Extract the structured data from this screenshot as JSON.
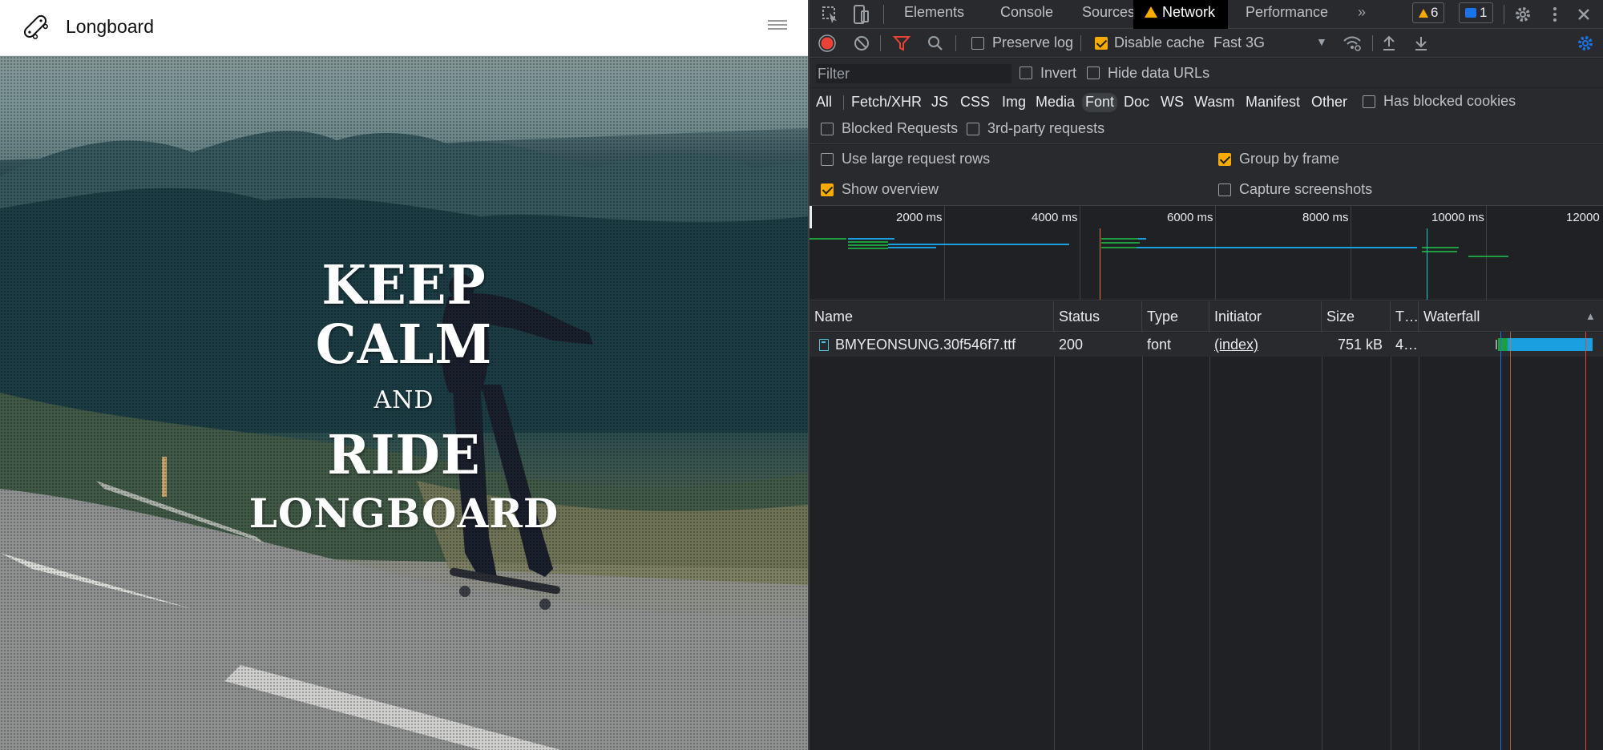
{
  "site": {
    "brand": "Longboard",
    "hero": {
      "line1": "KEEP",
      "line2": "CALM",
      "line3": "AND",
      "line4": "RIDE",
      "line5": "LONGBOARD"
    }
  },
  "devtools": {
    "tabs": [
      "Elements",
      "Console",
      "Sources",
      "Network",
      "Performance"
    ],
    "active_tab": "Network",
    "warnings_count": "6",
    "messages_count": "1",
    "toolbar": {
      "preserve_log": "Preserve log",
      "disable_cache": "Disable cache",
      "throttling": "Fast 3G"
    },
    "filter": {
      "placeholder": "Filter",
      "invert": "Invert",
      "hide_data_urls": "Hide data URLs"
    },
    "types": [
      "All",
      "Fetch/XHR",
      "JS",
      "CSS",
      "Img",
      "Media",
      "Font",
      "Doc",
      "WS",
      "Wasm",
      "Manifest",
      "Other"
    ],
    "selected_type": "Font",
    "has_blocked_cookies": "Has blocked cookies",
    "blocked_requests": "Blocked Requests",
    "third_party": "3rd-party requests",
    "settings": {
      "large_rows": "Use large request rows",
      "group_by_frame": "Group by frame",
      "show_overview": "Show overview",
      "capture_screenshots": "Capture screenshots"
    },
    "overview_ticks": [
      "2000 ms",
      "4000 ms",
      "6000 ms",
      "8000 ms",
      "10000 ms",
      "12000"
    ],
    "columns": [
      "Name",
      "Status",
      "Type",
      "Initiator",
      "Size",
      "T…",
      "Waterfall"
    ],
    "rows": [
      {
        "name": "BMYEONSUNG.30f546f7.ttf",
        "status": "200",
        "type": "font",
        "initiator": "(index)",
        "size": "751 kB",
        "time": "4…"
      }
    ],
    "colors": {
      "accent_orange": "#f9ab00",
      "request_blue": "#1a9fe0",
      "request_green": "#1e9e3e",
      "record_red": "#ea4335"
    }
  }
}
